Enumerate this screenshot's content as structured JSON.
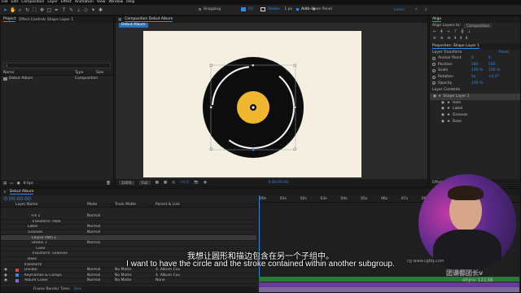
{
  "menu": [
    "File",
    "Edit",
    "Composition",
    "Layer",
    "Effect",
    "Animation",
    "View",
    "Window",
    "Help"
  ],
  "toolbar": {
    "snapping": "Snapping",
    "fill_label": "Fill",
    "stroke_label": "Stroke",
    "stroke_px": "1 px",
    "add_label": "Add:",
    "auto_open": "Auto-Open Panel",
    "workspace": "Learn"
  },
  "project": {
    "tab_project": "Project",
    "tab_effect": "Effect Controls Shape Layer 1",
    "col_name": "Name",
    "col_type": "Type",
    "col_size": "Size",
    "item_name": "Debut Album",
    "item_type": "Composition",
    "bpc": "8 bpc"
  },
  "comp": {
    "tab": "Composition Debut Album",
    "flow_tab": "Debut Album",
    "zoom": "100%",
    "quality": "Full",
    "exposure": "+0.0",
    "timecode": "0:00:00:00"
  },
  "align": {
    "title": "Align",
    "align_to_label": "Align Layers to:",
    "align_to_value": "Composition"
  },
  "properties": {
    "title": "Properties: Shape Layer 1",
    "transform_label": "Layer Transform",
    "reset": "Reset",
    "rows": [
      {
        "label": "Anchor Point",
        "v1": "0",
        "v2": "0"
      },
      {
        "label": "Position",
        "v1": "540",
        "v2": "540"
      },
      {
        "label": "Scale",
        "v1": "100 %",
        "v2": "100 %"
      },
      {
        "label": "Rotation",
        "v1": "0x",
        "v2": "+0.0°"
      },
      {
        "label": "Opacity",
        "v1": "100 %",
        "v2": ""
      }
    ],
    "contents_label": "Layer Contents",
    "contents": [
      "Shape Layer 1",
      "Hole",
      "Label",
      "Grooves",
      "Base"
    ]
  },
  "effects_panel": "Effects & Presets",
  "timeline": {
    "tab": "Debut Album",
    "timecode": "0:00:00:00",
    "col_layer": "Layer Name",
    "col_mode": "Mode",
    "col_trkmat": "Track Matte",
    "col_parent": "Parent & Link",
    "rows": [
      {
        "indent": 4,
        "name": "Fill 1",
        "mode": "Normal",
        "trk": "",
        "parent": ""
      },
      {
        "indent": 4,
        "name": "Transform: Hole",
        "mode": "",
        "trk": "",
        "parent": ""
      },
      {
        "indent": 3,
        "name": "Label",
        "mode": "Normal",
        "trk": "",
        "parent": ""
      },
      {
        "indent": 3,
        "name": "Grooves",
        "mode": "Normal",
        "trk": "",
        "parent": ""
      },
      {
        "indent": 4,
        "name": "Ellipse Path 1",
        "mode": "",
        "trk": "",
        "parent": ""
      },
      {
        "indent": 4,
        "name": "Stroke 1",
        "mode": "Normal",
        "trk": "",
        "parent": ""
      },
      {
        "indent": 5,
        "name": "Color",
        "mode": "",
        "trk": "",
        "parent": ""
      },
      {
        "indent": 4,
        "name": "Transform: Grooves",
        "mode": "",
        "trk": "",
        "parent": ""
      },
      {
        "indent": 3,
        "name": "Base",
        "mode": "",
        "trk": "",
        "parent": ""
      },
      {
        "indent": 2,
        "name": "Transform",
        "mode": "",
        "trk": "",
        "parent": ""
      },
      {
        "indent": 1,
        "name": "Divider",
        "mode": "Normal",
        "trk": "No Matte",
        "parent": "4. Album Cov"
      },
      {
        "indent": 1,
        "name": "Keyframes & Comps",
        "mode": "Normal",
        "trk": "No Matte",
        "parent": "4. Album Cov"
      },
      {
        "indent": 1,
        "name": "Album Cover",
        "mode": "Normal",
        "trk": "No Matte",
        "parent": "None"
      }
    ],
    "render_time_label": "Frame Render Time:",
    "render_time_value": "1ms",
    "ruler": [
      "00s",
      "01s",
      "02s",
      "03s",
      "04s",
      "05s",
      "06s",
      "07s",
      "08s",
      "09s",
      "10s",
      "11s",
      "12s"
    ]
  },
  "subtitle": {
    "cn": "我想让圆形和描边包含在另一个子组中。",
    "en": "I want to have the circle and the stroke contained within another subgroup."
  },
  "watermark": {
    "line1": "cg www.cgtiq.com",
    "line2": "团课都团长v",
    "line3": "ehjnv 12138"
  },
  "colors": {
    "canvas": "#f5efe2",
    "disc": "#0d0d0d",
    "label": "#f0b62e",
    "accent": "#2d8ceb",
    "bar_green": "#2a7a3a",
    "bar_purple": "#6a3a9a"
  }
}
